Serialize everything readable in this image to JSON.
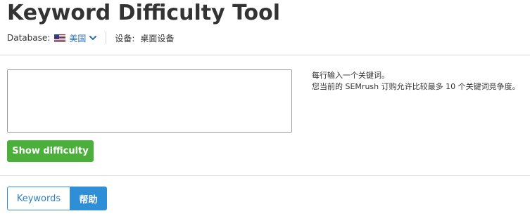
{
  "page": {
    "title": "Keyword Difficulty Tool"
  },
  "meta": {
    "database_label": "Database:",
    "database_value": "美国",
    "database_flag": "us-flag-icon",
    "device_label": "设备:",
    "device_value": "桌面设备"
  },
  "input": {
    "value": "",
    "placeholder": ""
  },
  "hint": {
    "line1": "每行输入一个关键词。",
    "line2": "您当前的 SEMrush 订购允许比较最多 10 个关键词竞争度。"
  },
  "actions": {
    "submit_label": "Show difficulty"
  },
  "tabs": [
    {
      "label": "Keywords",
      "active": false
    },
    {
      "label": "帮助",
      "active": true
    }
  ],
  "colors": {
    "primary_green": "#4caf3c",
    "accent_blue": "#2f8fd6",
    "link_blue": "#2a6fb5"
  }
}
